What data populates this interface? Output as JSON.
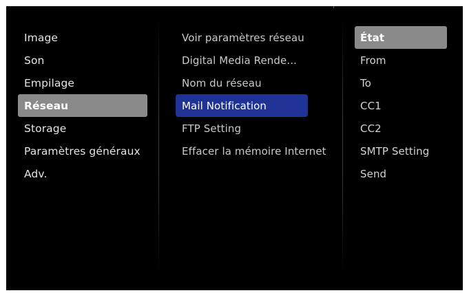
{
  "menu": {
    "main_items": [
      {
        "label": "Image"
      },
      {
        "label": "Son"
      },
      {
        "label": "Empilage"
      },
      {
        "label": "Réseau",
        "selected": true
      },
      {
        "label": "Storage"
      },
      {
        "label": "Paramètres généraux"
      },
      {
        "label": "Adv."
      }
    ],
    "network_items": [
      {
        "label": "Voir paramètres réseau"
      },
      {
        "label": "Digital Media Rende..."
      },
      {
        "label": "Nom du réseau"
      },
      {
        "label": "Mail Notification",
        "selected": true
      },
      {
        "label": "FTP Setting"
      },
      {
        "label": "Effacer la mémoire Internet"
      }
    ],
    "mail_items": [
      {
        "label": "État",
        "selected": true
      },
      {
        "label": "From"
      },
      {
        "label": "To"
      },
      {
        "label": "CC1"
      },
      {
        "label": "CC2"
      },
      {
        "label": "SMTP Setting"
      },
      {
        "label": "Send"
      }
    ]
  },
  "colors": {
    "background": "#000000",
    "focus_highlight": "#1f3296",
    "selection_highlight": "#8a8a8a",
    "text": "#e4e4e4"
  }
}
